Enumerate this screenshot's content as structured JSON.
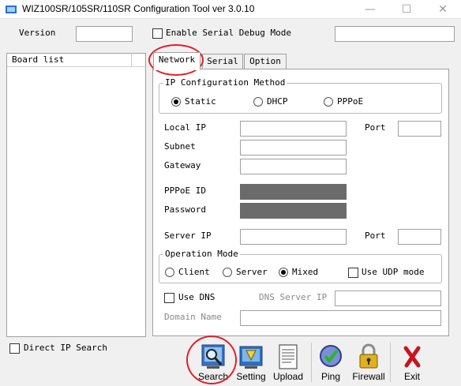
{
  "window": {
    "title": "WIZ100SR/105SR/110SR Configuration Tool ver 3.0.10",
    "min": "—",
    "max": "☐",
    "close": "✕"
  },
  "header": {
    "version_label": "Version",
    "version_value": "",
    "debug_label": "Enable Serial Debug Mode",
    "debug_value": ""
  },
  "board_list": {
    "header": "Board list",
    "items": []
  },
  "direct_ip": {
    "label": "Direct IP Search"
  },
  "tabs": [
    {
      "label": "Network"
    },
    {
      "label": "Serial"
    },
    {
      "label": "Option"
    }
  ],
  "ip_config": {
    "title": "IP Configuration Method",
    "options": [
      {
        "label": "Static",
        "selected": true
      },
      {
        "label": "DHCP",
        "selected": false
      },
      {
        "label": "PPPoE",
        "selected": false
      }
    ]
  },
  "fields": {
    "local_ip": {
      "label": "Local IP",
      "value": ""
    },
    "port": {
      "label": "Port",
      "value": ""
    },
    "subnet": {
      "label": "Subnet",
      "value": ""
    },
    "gateway": {
      "label": "Gateway",
      "value": ""
    },
    "pppoe_id": {
      "label": "PPPoE ID",
      "value": ""
    },
    "password": {
      "label": "Password",
      "value": ""
    },
    "server_ip": {
      "label": "Server IP",
      "value": ""
    },
    "server_port": {
      "label": "Port",
      "value": ""
    }
  },
  "operation": {
    "title": "Operation Mode",
    "options": [
      {
        "label": "Client",
        "selected": false
      },
      {
        "label": "Server",
        "selected": false
      },
      {
        "label": "Mixed",
        "selected": true
      }
    ],
    "udp_label": "Use UDP mode"
  },
  "dns": {
    "use_label": "Use DNS",
    "server_label": "DNS Server IP",
    "server_value": "",
    "domain_label": "Domain Name",
    "domain_value": ""
  },
  "toolbar": [
    {
      "label": "Search",
      "icon": "search-icon"
    },
    {
      "label": "Setting",
      "icon": "setting-icon"
    },
    {
      "label": "Upload",
      "icon": "upload-icon"
    },
    {
      "label": "Ping",
      "icon": "ping-icon"
    },
    {
      "label": "Firewall",
      "icon": "firewall-icon"
    },
    {
      "label": "Exit",
      "icon": "exit-icon"
    }
  ],
  "colors": {
    "highlight": "#e0202a",
    "disabled_field": "#6b6b6b"
  }
}
